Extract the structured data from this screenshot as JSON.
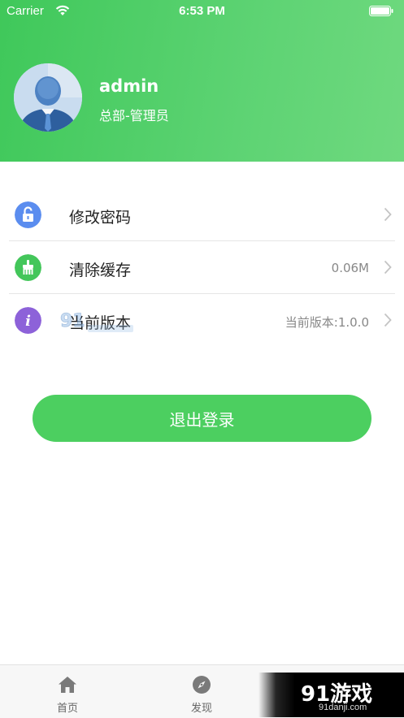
{
  "status_bar": {
    "carrier": "Carrier",
    "time": "6:53 PM"
  },
  "profile": {
    "name": "admin",
    "role": "总部-管理员"
  },
  "menu": {
    "items": [
      {
        "label": "修改密码",
        "value": "",
        "icon": "lock-icon",
        "color": "#5b8def"
      },
      {
        "label": "清除缓存",
        "value": "0.06M",
        "icon": "broom-icon",
        "color": "#43c65a"
      },
      {
        "label": "当前版本",
        "value": "当前版本:1.0.0",
        "icon": "info-icon",
        "color": "#8d62d9"
      }
    ]
  },
  "logout_label": "退出登录",
  "tabs": [
    {
      "label": "首页",
      "icon": "home-icon"
    },
    {
      "label": "发现",
      "icon": "compass-icon"
    }
  ],
  "watermark": {
    "text": "91游戏",
    "sub": "91danji.com"
  },
  "colors": {
    "header_start": "#3fc85a",
    "header_end": "#6fd97f",
    "accent": "#4ccf60"
  }
}
